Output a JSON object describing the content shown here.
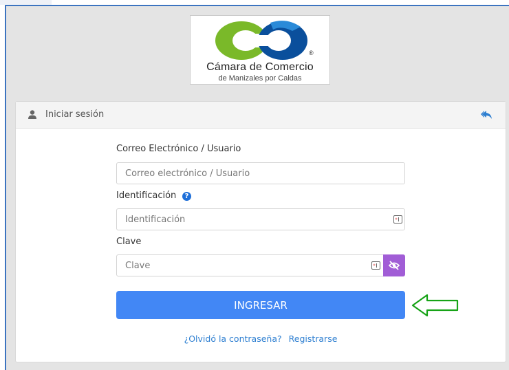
{
  "logo": {
    "name_line1": "Cámara de Comercio",
    "name_line2": "de Manizales por Caldas",
    "registered_mark": "®",
    "colors": {
      "green": "#7ab929",
      "blue": "#0a4f9c",
      "light_blue": "#2a8ad8"
    }
  },
  "panel": {
    "title": "Iniciar sesión",
    "user_icon": "user-icon",
    "back_icon": "reply-arrow-icon"
  },
  "form": {
    "email_label": "Correo Electrónico / Usuario",
    "email_placeholder": "Correo electrónico / Usuario",
    "email_value": "",
    "id_label": "Identificación",
    "id_help_glyph": "?",
    "id_placeholder": "Identificación",
    "id_value": "",
    "password_label": "Clave",
    "password_placeholder": "Clave",
    "password_value": "",
    "submit_label": "INGRESAR",
    "forgot_link": "¿Olvidó la contraseña?",
    "register_link": "Registrarse"
  },
  "colors": {
    "primary_button": "#4287f5",
    "eye_toggle": "#a15dd6",
    "link": "#2e7fd1",
    "annotation_arrow": "#17a317"
  }
}
